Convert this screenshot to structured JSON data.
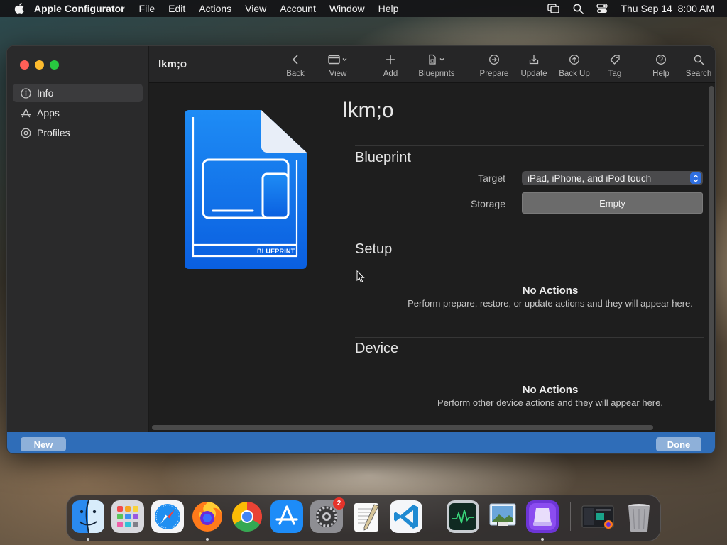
{
  "menubar": {
    "app_name": "Apple Configurator",
    "items": [
      "File",
      "Edit",
      "Actions",
      "View",
      "Account",
      "Window",
      "Help"
    ],
    "clock": "Thu Sep 14  8:00 AM"
  },
  "window": {
    "title": "lkm;o",
    "sidebar": {
      "items": [
        {
          "label": "Info",
          "icon": "info-circle-icon",
          "selected": true
        },
        {
          "label": "Apps",
          "icon": "app-store-icon",
          "selected": false
        },
        {
          "label": "Profiles",
          "icon": "gear-badge-icon",
          "selected": false
        }
      ]
    },
    "toolbar": {
      "buttons": [
        {
          "label": "Back",
          "icon": "chevron-left-icon"
        },
        {
          "label": "View",
          "icon": "window-icon"
        },
        {
          "label": "Add",
          "icon": "plus-icon"
        },
        {
          "label": "Blueprints",
          "icon": "blueprint-icon"
        },
        {
          "label": "Prepare",
          "icon": "prepare-icon"
        },
        {
          "label": "Update",
          "icon": "update-icon"
        },
        {
          "label": "Back Up",
          "icon": "backup-icon"
        },
        {
          "label": "Tag",
          "icon": "tag-icon"
        },
        {
          "label": "Help",
          "icon": "question-circle-icon"
        },
        {
          "label": "Search",
          "icon": "search-icon"
        }
      ]
    },
    "document": {
      "icon_badge_text": "BLUEPRINT",
      "heading": "lkm;o"
    },
    "blueprint_section": {
      "title": "Blueprint",
      "target_label": "Target",
      "target_value": "iPad, iPhone, and iPod touch",
      "storage_label": "Storage",
      "storage_value": "Empty"
    },
    "setup_section": {
      "title": "Setup",
      "empty_title": "No Actions",
      "empty_text": "Perform prepare, restore, or update actions and they will appear here."
    },
    "device_section": {
      "title": "Device",
      "empty_title": "No Actions",
      "empty_text": "Perform other device actions and they will appear here."
    },
    "bottom_bar": {
      "new_label": "New",
      "done_label": "Done"
    }
  },
  "dock": {
    "apps": [
      "Finder",
      "Launchpad",
      "Safari",
      "Firefox",
      "Chrome",
      "App Store",
      "System Settings",
      "TextEdit",
      "Visual Studio Code",
      "Activity Monitor",
      "Preview",
      "Apple Configurator",
      "Recent Window",
      "Trash"
    ],
    "settings_badge": "2"
  },
  "colors": {
    "accent_blue": "#2f6db8",
    "window_bg": "#1e1e1e",
    "sidebar_bg": "#2a2a2b"
  }
}
